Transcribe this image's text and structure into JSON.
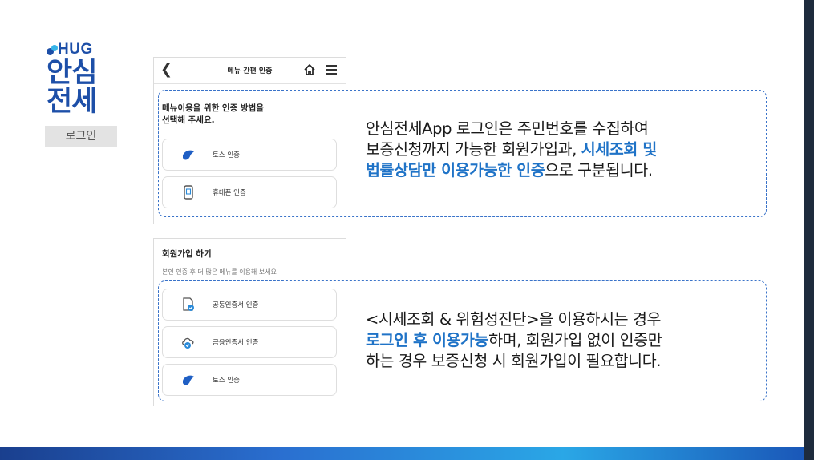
{
  "brand": {
    "logo_text": "HUG",
    "title_line1": "안심",
    "title_line2": "전세",
    "tab_label": "로그인"
  },
  "phone_header": {
    "back_icon": "chevron-left-icon",
    "title": "메뉴 간편 인증",
    "home_icon": "home-icon",
    "menu_icon": "hamburger-menu-icon"
  },
  "auth_section": {
    "title_line1": "메뉴이용을 위한 인증 방법을",
    "title_line2": "선택해 주세요.",
    "buttons": [
      {
        "label": "토스 인증",
        "icon": "toss-icon"
      },
      {
        "label": "휴대폰 인증",
        "icon": "phone-icon"
      }
    ]
  },
  "signup_section": {
    "title": "회원가입 하기",
    "subtitle": "본인 인증 후 더 많은 메뉴를 이용해 보세요",
    "buttons": [
      {
        "label": "공동인증서 인증",
        "icon": "certificate-document-icon"
      },
      {
        "label": "금융인증서 인증",
        "icon": "cloud-check-icon"
      },
      {
        "label": "토스 인증",
        "icon": "toss-icon"
      }
    ]
  },
  "callout1": {
    "line1": "안심전세App 로그인은 주민번호를 수집하여",
    "line2_plain": "보증신청까지 가능한 회원가입과, ",
    "line2_highlight": "시세조회 및",
    "line3_highlight": "법률상담만 이용가능한 인증",
    "line3_plain": "으로 구분됩니다."
  },
  "callout2": {
    "line1": "<시세조회 & 위험성진단>을 이용하시는 경우",
    "line2_highlight": "로그인 후 이용가능",
    "line2_plain": "하며, 회원가입 없이 인증만",
    "line3": "하는 경우 보증신청 시 회원가입이 필요합니다."
  },
  "colors": {
    "brand_blue": "#1d4fa8",
    "highlight_blue": "#1f73c7",
    "callout_border": "#3a73c9"
  }
}
